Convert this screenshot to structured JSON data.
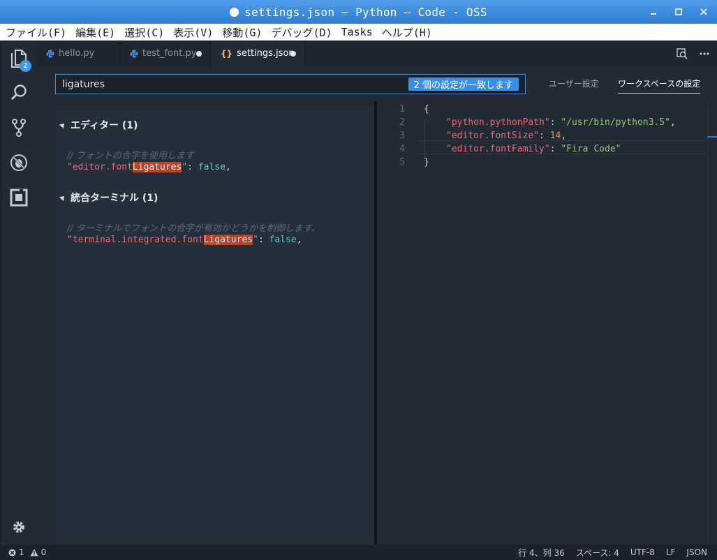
{
  "window": {
    "title": "settings.json — Python — Code - OSS",
    "controls": {
      "minimize": "_",
      "maximize": "☐",
      "close": "✕"
    }
  },
  "menu": [
    "ファイル(F)",
    "編集(E)",
    "選択(C)",
    "表示(V)",
    "移動(G)",
    "デバッグ(D)",
    "Tasks",
    "ヘルプ(H)"
  ],
  "activity": {
    "explorer_badge": "2"
  },
  "tabs": [
    {
      "label": "hello.py",
      "icon": "python-icon",
      "dirty": false
    },
    {
      "label": "test_font.py",
      "icon": "python-icon",
      "dirty": true
    },
    {
      "label": "settings.json",
      "icon": "json-braces-icon",
      "braces": "{}",
      "dirty": true,
      "active": true
    }
  ],
  "search": {
    "value": "ligatures",
    "match_badge": "2 個の設定が一致します"
  },
  "scopes": {
    "user": "ユーザー設定",
    "workspace": "ワークスペースの設定"
  },
  "groups": [
    {
      "title": "エディター (1)",
      "comment": "// フォントの合字を使用します",
      "key_prefix": "\"editor.font",
      "key_highlight": "Ligatures",
      "key_suffix": "\"",
      "separator": ": ",
      "value": "false",
      "trailing": ","
    },
    {
      "title": "統合ターミナル (1)",
      "comment": "// ターミナルでフォントの合字が有効かどうかを制御します。",
      "key_prefix": "\"terminal.integrated.font",
      "key_highlight": "Ligatures",
      "key_suffix": "\"",
      "separator": ": ",
      "value": "false",
      "trailing": ","
    }
  ],
  "editor": {
    "line_numbers": [
      "1",
      "2",
      "3",
      "4",
      "5"
    ],
    "open_brace": "{",
    "close_brace": "}",
    "entries": [
      {
        "key": "\"python.pythonPath\"",
        "sep": ": ",
        "value": "\"/usr/bin/python3.5\"",
        "type": "string",
        "trail": ","
      },
      {
        "key": "\"editor.fontSize\"",
        "sep": ": ",
        "value": "14",
        "type": "number",
        "trail": ","
      },
      {
        "key": "\"editor.fontFamily\"",
        "sep": ": ",
        "value": "\"Fira Code\"",
        "type": "string",
        "trail": ""
      }
    ]
  },
  "status": {
    "errors": "1",
    "warnings": "0",
    "position": "行 4、列 36",
    "indent": "スペース: 4",
    "encoding": "UTF-8",
    "eol": "LF",
    "language": "JSON"
  },
  "colors": {
    "accent": "#3a8ee6",
    "title_bar": "#2f7fd6",
    "editor_bg": "#222a35",
    "string_key": "#e36d7a",
    "string_value": "#98c379",
    "number": "#d19a66",
    "highlight": "#b2452a"
  }
}
